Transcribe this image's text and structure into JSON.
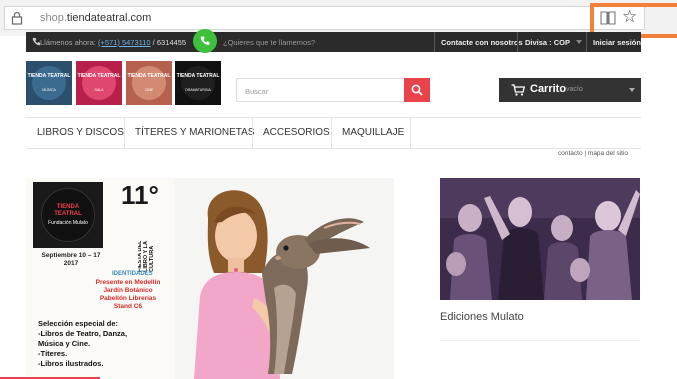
{
  "browser": {
    "url_prefix": "shop.",
    "url_domain": "tiendateatral.com",
    "reading_view_icon": "book-icon",
    "favorite_icon": "star-icon",
    "highlight_color": "#f0803c"
  },
  "topbar": {
    "call_label": "Llámenos ahora:",
    "phone_primary": "(+571) 5473110",
    "phone_secondary": " / 6314455",
    "callback_text": "¿Quieres que te llamemos?",
    "contact_label": "Contacte con nosotros",
    "currency_label": "Divisa : COP",
    "login_label": "Iniciar sesión"
  },
  "logos": [
    {
      "title": "TIENDA TEATRAL",
      "sub": "MÚSICA",
      "bg": "#2d4f6e",
      "circle": "#3c6b90"
    },
    {
      "title": "TIENDA TEATRAL",
      "sub": "SALA",
      "bg": "#b7204a",
      "circle": "#e0476f"
    },
    {
      "title": "TIENDA TEATRAL",
      "sub": "CINE",
      "bg": "#b5614e",
      "circle": "#d28a73"
    },
    {
      "title": "TIENDA TEATRAL",
      "sub": "DRAMATURGIA",
      "bg": "#111111",
      "circle": "#1f1f1f"
    }
  ],
  "search": {
    "placeholder": "Buscar",
    "button_color": "#e8424a"
  },
  "cart": {
    "label": "Carrito",
    "status": "vacío"
  },
  "nav": {
    "items": [
      "LIBROS Y DISCOS",
      "TÍTERES Y MARIONETAS",
      "ACCESORIOS",
      "MAQUILLAJE"
    ]
  },
  "sitelinks": {
    "contact": "contacto",
    "separator": "|",
    "sitemap": "mapa del sitio"
  },
  "banner": {
    "logo_line1": "TIENDA",
    "logo_line2": "TEATRAL",
    "logo_sub": "Fundación Mulato",
    "date_line1": "Septiembre 10 – 17",
    "date_line2": "2017",
    "edition": "11°",
    "fiesta_line1": "FIESTA DEL",
    "fiesta_line2": "LIBRO Y LA",
    "fiesta_line3": "CULTURA",
    "identidades": "IDENTIDADES",
    "place_line1": "Presente en Medellín",
    "place_line2": "Jardín Botánico",
    "place_line3": "Pabellón Librerías",
    "place_line4": "Stand C6",
    "sel_line1": "Selección especial de:",
    "sel_line2": "-Libros de Teatro, Danza,",
    "sel_line3": "Música y Cine.",
    "sel_line4": "-Títeres.",
    "sel_line5": "-Libros ilustrados."
  },
  "promo": {
    "title": "Ediciones Mulato"
  }
}
